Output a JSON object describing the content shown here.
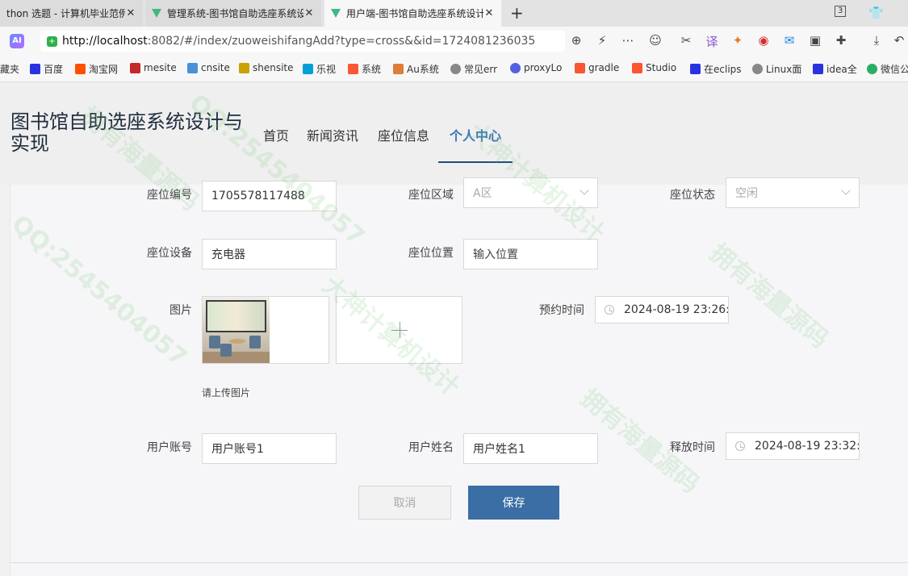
{
  "browser": {
    "tabs": [
      {
        "title": "thon 选题 - 计算机毕业范例"
      },
      {
        "title": "管理系统-图书馆自助选座系统设计"
      },
      {
        "title": "用户端-图书馆自助选座系统设计"
      }
    ],
    "close_glyph": "✕",
    "new_tab_glyph": "+",
    "url_host": "http://localhost",
    "url_rest": ":8082/#/index/zuoweishifangAdd?type=cross&&id=1724081236035",
    "ai_badge": "AI",
    "window_badge": "3",
    "bookmarks": [
      {
        "label": "藏夹",
        "icon": "folder-icon",
        "color": "#e8b64b"
      },
      {
        "label": "百度",
        "icon": "baidu-icon",
        "color": "#2932e1"
      },
      {
        "label": "淘宝网",
        "icon": "taobao-icon",
        "color": "#ff5000"
      },
      {
        "label": "mesite",
        "icon": "mesite-icon",
        "color": "#c62828"
      },
      {
        "label": "cnsite",
        "icon": "cnsite-icon",
        "color": "#4a90d9"
      },
      {
        "label": "shensite",
        "icon": "shensite-icon",
        "color": "#c9a100"
      },
      {
        "label": "乐视",
        "icon": "bilibili-icon",
        "color": "#00a1d6"
      },
      {
        "label": "系统",
        "icon": "csdn-icon",
        "color": "#fc5531"
      },
      {
        "label": "Au系统",
        "icon": "au-icon",
        "color": "#e07b39"
      },
      {
        "label": "常见err",
        "icon": "globe-icon",
        "color": "#888888"
      },
      {
        "label": "proxyLo",
        "icon": "proxy-icon",
        "color": "#5560e0"
      },
      {
        "label": "gradle",
        "icon": "csdn-icon",
        "color": "#fc5531"
      },
      {
        "label": "Studio",
        "icon": "csdn-icon",
        "color": "#fc5531"
      },
      {
        "label": "在eclips",
        "icon": "baidu-icon",
        "color": "#2932e1"
      },
      {
        "label": "Linux面",
        "icon": "globe-icon",
        "color": "#888888"
      },
      {
        "label": "idea全",
        "icon": "baidu-icon",
        "color": "#2932e1"
      },
      {
        "label": "微信公",
        "icon": "wechat-icon",
        "color": "#2aae67"
      }
    ]
  },
  "site": {
    "title": "图书馆自助选座系统设计与实现",
    "nav": [
      "首页",
      "新闻资讯",
      "座位信息",
      "个人中心"
    ],
    "active_nav_index": 3
  },
  "form": {
    "seat_no": {
      "label": "座位编号",
      "value": "1705578117488"
    },
    "seat_area": {
      "label": "座位区域",
      "value": "A区"
    },
    "seat_status": {
      "label": "座位状态",
      "value": "空闲"
    },
    "seat_equipment": {
      "label": "座位设备",
      "value": "充电器"
    },
    "seat_location": {
      "label": "座位位置",
      "placeholder": "输入位置"
    },
    "image": {
      "label": "图片",
      "hint": "请上传图片"
    },
    "reserve_time": {
      "label": "预约时间",
      "value": "2024-08-19 23:26:"
    },
    "user_account": {
      "label": "用户账号",
      "value": "用户账号1"
    },
    "user_name": {
      "label": "用户姓名",
      "value": "用户姓名1"
    },
    "release_time": {
      "label": "释放时间",
      "value": "2024-08-19 23:32:"
    },
    "cancel_label": "取消",
    "save_label": "保存"
  },
  "watermark": [
    "拥有海量源码",
    "QQ:2545404057",
    "大神计算机设计"
  ],
  "colors": {
    "accent": "#3a78b7",
    "save_button": "#3a6ea5",
    "nav_underline": "#1f4f7a"
  }
}
